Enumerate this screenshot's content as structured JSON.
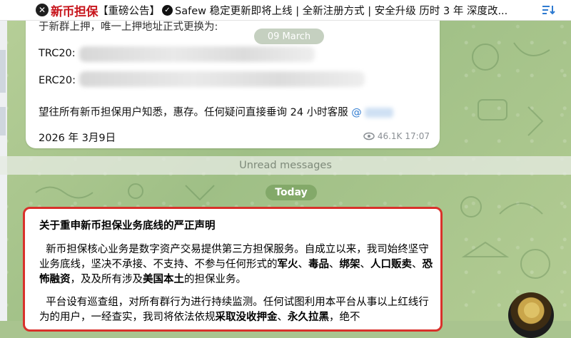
{
  "header": {
    "brand": "新币担保",
    "tag": "【重磅公告】",
    "text": "Safew 稳定更新即将上线 | 全新注册方式 | 安全升级 历时 3 年 深度改..."
  },
  "message1": {
    "partial_line": "于新群上押，唯一上押地址正式更换为:",
    "date_pill": "09 March",
    "trc_label": "TRC20:",
    "erc_label": "ERC20:",
    "notice": "望往所有新币担保用户知悉，惠存。任何疑问直接垂询 24 小时客服",
    "mention": "@",
    "date": "2026 年 3月9日",
    "views": "46.1K",
    "time": "17:07"
  },
  "unread_label": "Unread messages",
  "today_label": "Today",
  "message2": {
    "title": "关于重申新币担保业务底线的严正声明",
    "p1_a": "新币担保核心业务是数字资产交易提供第三方担保服务。自成立以来，我司始终坚守业务底线，坚决不承接、不支持、不参与任何形式的",
    "p1_b1": "军火",
    "p1_sep1": "、",
    "p1_b2": "毒品",
    "p1_sep2": "、",
    "p1_b3": "绑架",
    "p1_sep3": "、",
    "p1_b4": "人口贩卖",
    "p1_sep4": "、",
    "p1_b5": "恐怖融资",
    "p1_c": "，及及所有涉及",
    "p1_b6": "美国本土",
    "p1_d": "的担保业务。",
    "p2_a": "平台设有巡查组，对所有群行为进行持续监测。任何试图利用本平台从事以上红线行为的用户，一经查实，我司将依法依规",
    "p2_b1": "采取没收押金",
    "p2_sep": "、",
    "p2_b2": "永久拉黑",
    "p2_c": "，绝不"
  },
  "colors": {
    "brand_red": "#c8161d",
    "highlight_border": "#d9312b",
    "link": "#2f7bd1",
    "today_pill": "#78a05f"
  }
}
